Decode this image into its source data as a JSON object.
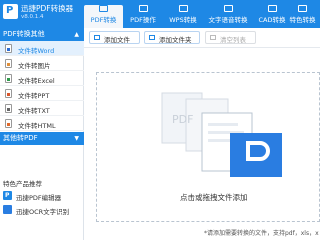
{
  "app": {
    "title": "迅捷PDF转换器",
    "version": "v8.0.1.4",
    "logo_letter": "P"
  },
  "tabs": [
    {
      "label": "PDF转换",
      "active": true
    },
    {
      "label": "PDF操作"
    },
    {
      "label": "WPS转换"
    },
    {
      "label": "文字语音转换"
    },
    {
      "label": "CAD转换"
    },
    {
      "label": "特色转换"
    }
  ],
  "sidebar": {
    "group_title": "PDF转换其他",
    "items": [
      {
        "label": "文件转Word",
        "active": true,
        "icon_color": "#2b6cd4"
      },
      {
        "label": "文件转图片",
        "icon_color": "#e0903a"
      },
      {
        "label": "文件转Excel",
        "icon_color": "#2e9b4a"
      },
      {
        "label": "文件转PPT",
        "icon_color": "#d9562b"
      },
      {
        "label": "文件转TXT",
        "icon_color": "#666666"
      },
      {
        "label": "文件转HTML",
        "icon_color": "#e06a2b"
      }
    ],
    "group2_title": "其他转PDF",
    "special_title": "特色产品推荐",
    "products": [
      {
        "label": "迅捷PDF编辑器"
      },
      {
        "label": "迅捷OCR文字识别"
      }
    ]
  },
  "toolbar": {
    "add_file": "添加文件",
    "add_folder": "添加文件夹",
    "clear_list": "清空列表"
  },
  "dropzone": {
    "hint": "点击或拖拽文件添加",
    "doc_tag": "PDF"
  },
  "footer_note": "*请添加需要转换的文件，支持pdf，xls，x",
  "colors": {
    "primary": "#1e88e5",
    "sidebar_active": "#e3f0fd",
    "background": "#f3f6fa"
  }
}
